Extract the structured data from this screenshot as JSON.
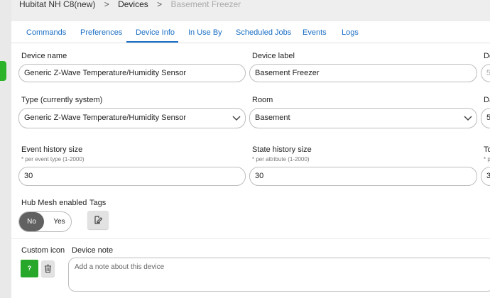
{
  "breadcrumb": {
    "root": "Hubitat NH C8(new)",
    "section": "Devices",
    "current": "Basement Freezer",
    "separator": ">"
  },
  "tabs": [
    {
      "label": "Commands"
    },
    {
      "label": "Preferences"
    },
    {
      "label": "Device Info",
      "active": true
    },
    {
      "label": "In Use By"
    },
    {
      "label": "Scheduled Jobs"
    },
    {
      "label": "Events"
    },
    {
      "label": "Logs"
    }
  ],
  "form": {
    "device_name": {
      "label": "Device name",
      "value": "Generic Z-Wave Temperature/Humidity Sensor"
    },
    "device_label": {
      "label": "Device label",
      "value": "Basement Freezer"
    },
    "col3_row1": {
      "label": "De",
      "value": "5"
    },
    "type": {
      "label": "Type (currently system)",
      "value": "Generic Z-Wave Temperature/Humidity Sensor"
    },
    "room": {
      "label": "Room",
      "value": "Basement"
    },
    "col3_row2": {
      "label": "Da",
      "value": "5"
    },
    "event_history": {
      "label": "Event history size",
      "hint": "* per event type (1-2000)",
      "value": "30"
    },
    "state_history": {
      "label": "State history size",
      "hint": "* per attribute (1-2000)",
      "value": "30"
    },
    "col3_row3": {
      "label": "To",
      "hint": "* p",
      "value": "3"
    },
    "hub_mesh": {
      "label": "Hub Mesh enabled",
      "no": "No",
      "yes": "Yes",
      "selected": "No"
    },
    "tags": {
      "label": "Tags"
    },
    "custom_icon": {
      "label": "Custom icon",
      "button_text": "?"
    },
    "device_note": {
      "label": "Device note",
      "placeholder": "Add a note about this device"
    }
  },
  "colors": {
    "accent": "#1a6ec4",
    "green": "#27a82b",
    "toggle_selected": "#616161"
  }
}
